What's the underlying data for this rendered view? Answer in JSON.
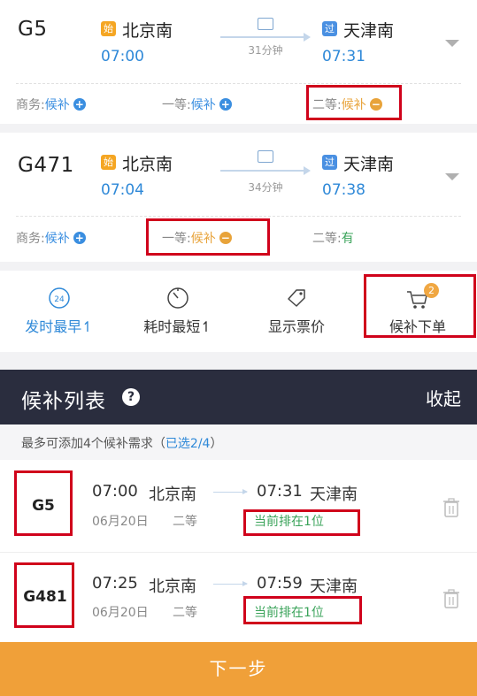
{
  "trains": [
    {
      "number": "G5",
      "from_badge": "始",
      "from_station": "北京南",
      "depart_time": "07:00",
      "duration": "31分钟",
      "to_badge": "过",
      "to_station": "天津南",
      "arrive_time": "07:31",
      "seats": [
        {
          "label": "商务:",
          "value": "候补",
          "icon": "+"
        },
        {
          "label": "一等:",
          "value": "候补",
          "icon": "+"
        },
        {
          "label": "二等:",
          "value": "候补",
          "icon": "−"
        }
      ]
    },
    {
      "number": "G471",
      "from_badge": "始",
      "from_station": "北京南",
      "depart_time": "07:04",
      "duration": "34分钟",
      "to_badge": "过",
      "to_station": "天津南",
      "arrive_time": "07:38",
      "seats": [
        {
          "label": "商务:",
          "value": "候补",
          "icon": "+"
        },
        {
          "label": "一等:",
          "value": "候补",
          "icon": "−"
        },
        {
          "label": "二等:",
          "value": "有"
        }
      ]
    }
  ],
  "train_icon_text": "",
  "sort_bar": [
    {
      "label": "发时最早↿",
      "icon": "clock-24-icon",
      "icon_text": "24"
    },
    {
      "label": "耗时最短↿",
      "icon": "timer-icon"
    },
    {
      "label": "显示票价",
      "icon": "price-tag-icon"
    },
    {
      "label": "候补下单",
      "icon": "cart-icon",
      "badge": "2"
    }
  ],
  "waitlist": {
    "title": "候补列表",
    "help": "?",
    "collapse_label": "收起",
    "info_prefix": "最多可添加4个候补需求（",
    "info_selected": "已选2/4",
    "info_suffix": "）",
    "orders": [
      {
        "train": "G5",
        "depart_time": "07:00",
        "from": "北京南",
        "arrive_time": "07:31",
        "to": "天津南",
        "date": "06月20日",
        "seat_class": "二等",
        "rank": "当前排在1位"
      },
      {
        "train": "G481",
        "depart_time": "07:25",
        "from": "北京南",
        "arrive_time": "07:59",
        "to": "天津南",
        "date": "06月20日",
        "seat_class": "二等",
        "rank": "当前排在1位"
      }
    ]
  },
  "next_button": "下一步",
  "colors": {
    "accent_blue": "#2f89d8",
    "orange": "#f0a039",
    "green": "#3aa35a",
    "highlight_red": "#d0021b",
    "header_dark": "#2a2d3e"
  }
}
